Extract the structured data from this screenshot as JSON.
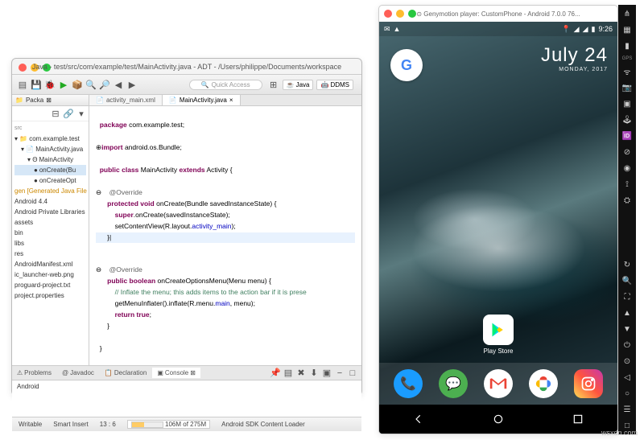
{
  "eclipse": {
    "title": "Java - test/src/com/example/test/MainActivity.java - ADT - /Users/philippe/Documents/workspace",
    "quick_access": "Quick Access",
    "perspectives": {
      "java": "Java",
      "ddms": "DDMS"
    },
    "package_explorer": {
      "tab": "Packa",
      "root": "com.example.test",
      "src_folder": "src",
      "file": "MainActivity.java",
      "class": "MainActivity",
      "method1": "onCreate(Bu",
      "method2": "onCreateOpt",
      "gen": "gen [Generated Java File",
      "android": "Android 4.4",
      "private_libs": "Android Private Libraries",
      "assets": "assets",
      "bin": "bin",
      "libs": "libs",
      "res": "res",
      "manifest": "AndroidManifest.xml",
      "launcher": "ic_launcher-web.png",
      "proguard": "proguard-project.txt",
      "project_props": "project.properties"
    },
    "tabs": {
      "xml": "activity_main.xml",
      "java": "MainActivity.java"
    },
    "code": {
      "l1_a": "package",
      "l1_b": " com.example.test;",
      "l2_a": "import",
      "l2_b": " android.os.Bundle;",
      "l3_a": "public class",
      "l3_b": " MainActivity ",
      "l3_c": "extends",
      "l3_d": " Activity {",
      "l4": "@Override",
      "l5_a": "protected void",
      "l5_b": " onCreate(Bundle savedInstanceState) {",
      "l6_a": "super",
      "l6_b": ".onCreate(savedInstanceState);",
      "l7_a": "setContentView(R.layout.",
      "l7_b": "activity_main",
      "l7_c": ");",
      "l8": "}",
      "l9": "@Override",
      "l10_a": "public boolean",
      "l10_b": " onCreateOptionsMenu(Menu menu) {",
      "l11": "// Inflate the menu; this adds items to the action bar if it is prese",
      "l12_a": "getMenuInflater().inflate(R.menu.",
      "l12_b": "main",
      "l12_c": ", menu);",
      "l13_a": "return",
      "l13_b": " true",
      "l13_c": ";",
      "l14": "}",
      "l15": "}"
    },
    "bottom": {
      "problems": "Problems",
      "javadoc": "Javadoc",
      "declaration": "Declaration",
      "console": "Console",
      "console_text": "Android"
    },
    "status": {
      "writable": "Writable",
      "insert": "Smart Insert",
      "pos": "13 : 6",
      "mem": "106M of 275M",
      "loader": "Android SDK Content Loader"
    }
  },
  "emulator": {
    "title": "Genymotion player: CustomPhone - Android 7.0.0 76...",
    "time": "9:26",
    "date": "July 24",
    "date_sub": "MONDAY, 2017",
    "play_store": "Play Store",
    "side_gps": "GPS"
  },
  "watermark": "wsxdn.com"
}
